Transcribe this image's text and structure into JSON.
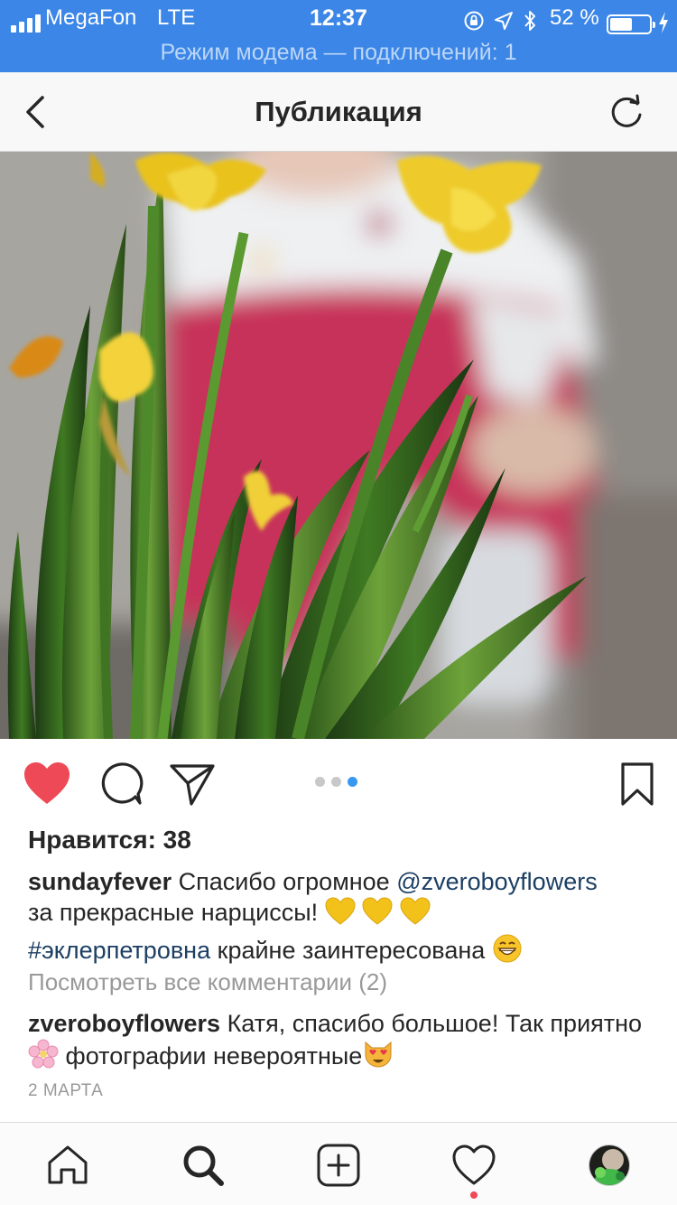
{
  "status_bar": {
    "carrier": "MegaFon",
    "network": "LTE",
    "time": "12:37",
    "battery": "52 %",
    "battery_level": 0.52,
    "hotspot": "Режим модема — подключений: 1"
  },
  "nav": {
    "title": "Публикация",
    "back_icon": "chevron-left-icon",
    "refresh_icon": "refresh-icon"
  },
  "post": {
    "carousel": {
      "count": 3,
      "active": 3
    },
    "likes": "Нравится: 38",
    "caption": {
      "username": "sundayfever",
      "text_before_mention": "Спасибо огромное",
      "mention": "@zveroboyflowers",
      "text_line2": "за прекрасные нарциссы!",
      "hearts": [
        "💛",
        "💛",
        "💛"
      ],
      "hashtag": "#эклерпетровна",
      "text_after_hashtag": "крайне заинтересована",
      "end_emoji": "😁"
    },
    "view_all": "Посмотреть все комментарии (2)",
    "comment": {
      "username": "zveroboyflowers",
      "text1": "Катя, спасибо большое! Так приятно",
      "flower_emoji": "🌸",
      "text2": "фотографии невероятные",
      "end_emoji": "😻"
    },
    "date": "2 МАРТА"
  },
  "colors": {
    "status_bar": "#3b86e6",
    "like_red": "#ed4956",
    "link": "#1c3f63",
    "carousel_active": "#3897f0"
  },
  "tab_bar": {
    "items": [
      "home-icon",
      "search-icon",
      "add-post-icon",
      "activity-heart-icon",
      "profile-avatar"
    ]
  }
}
